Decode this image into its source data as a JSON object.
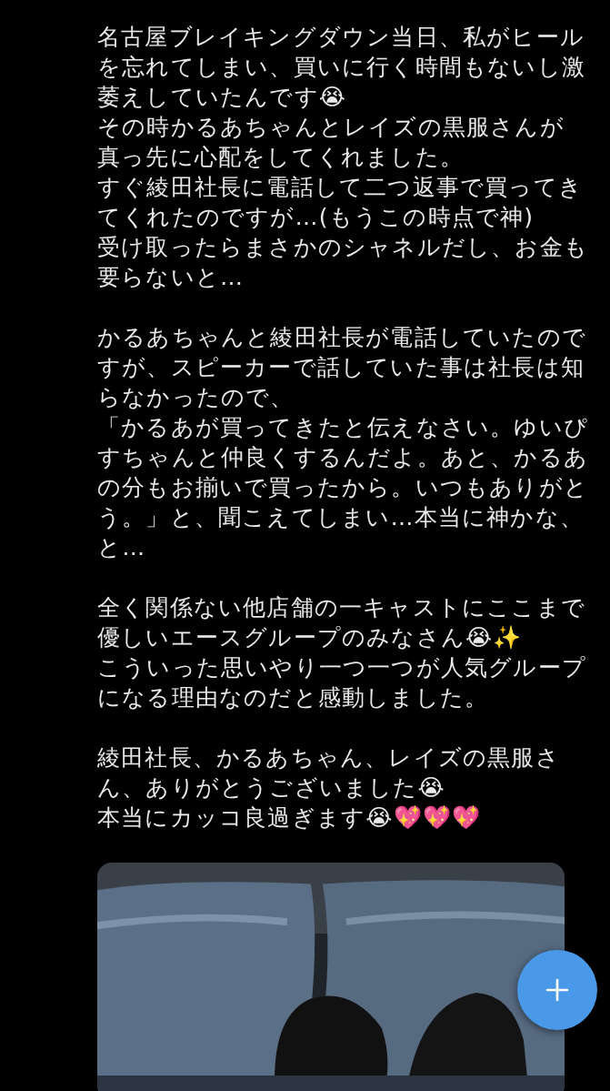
{
  "post": {
    "paragraphs": [
      {
        "lines": [
          "名古屋ブレイキングダウン当日、私がヒールを忘れてしまい、買いに行く時間もないし激萎えしていたんです😭",
          "その時かるあちゃんとレイズの黒服さんが",
          "真っ先に心配をしてくれました。",
          "すぐ綾田社長に電話して二つ返事で買ってきてくれたのですが…(もうこの時点で神)",
          "受け取ったらまさかのシャネルだし、お金も要らないと…"
        ]
      },
      {
        "lines": [
          "かるあちゃんと綾田社長が電話していたのですが、スピーカーで話していた事は社長は知らなかったので、",
          "「かるあが買ってきたと伝えなさい。ゆいぴすちゃんと仲良くするんだよ。あと、かるあの分もお揃いで買ったから。いつもありがとう。」と、聞こえてしまい…本当に神かな、と…"
        ]
      },
      {
        "lines": [
          "全く関係ない他店舗の一キャストにここまで優しいエースグループのみなさん😭✨",
          "こういった思いやり一つ一つが人気グループになる理由なのだと感動しました。"
        ]
      },
      {
        "lines": [
          "綾田社長、かるあちゃん、レイズの黒服さん、ありがとうございました😭",
          "本当にカッコ良過ぎます😭💖💖💖"
        ]
      }
    ]
  }
}
